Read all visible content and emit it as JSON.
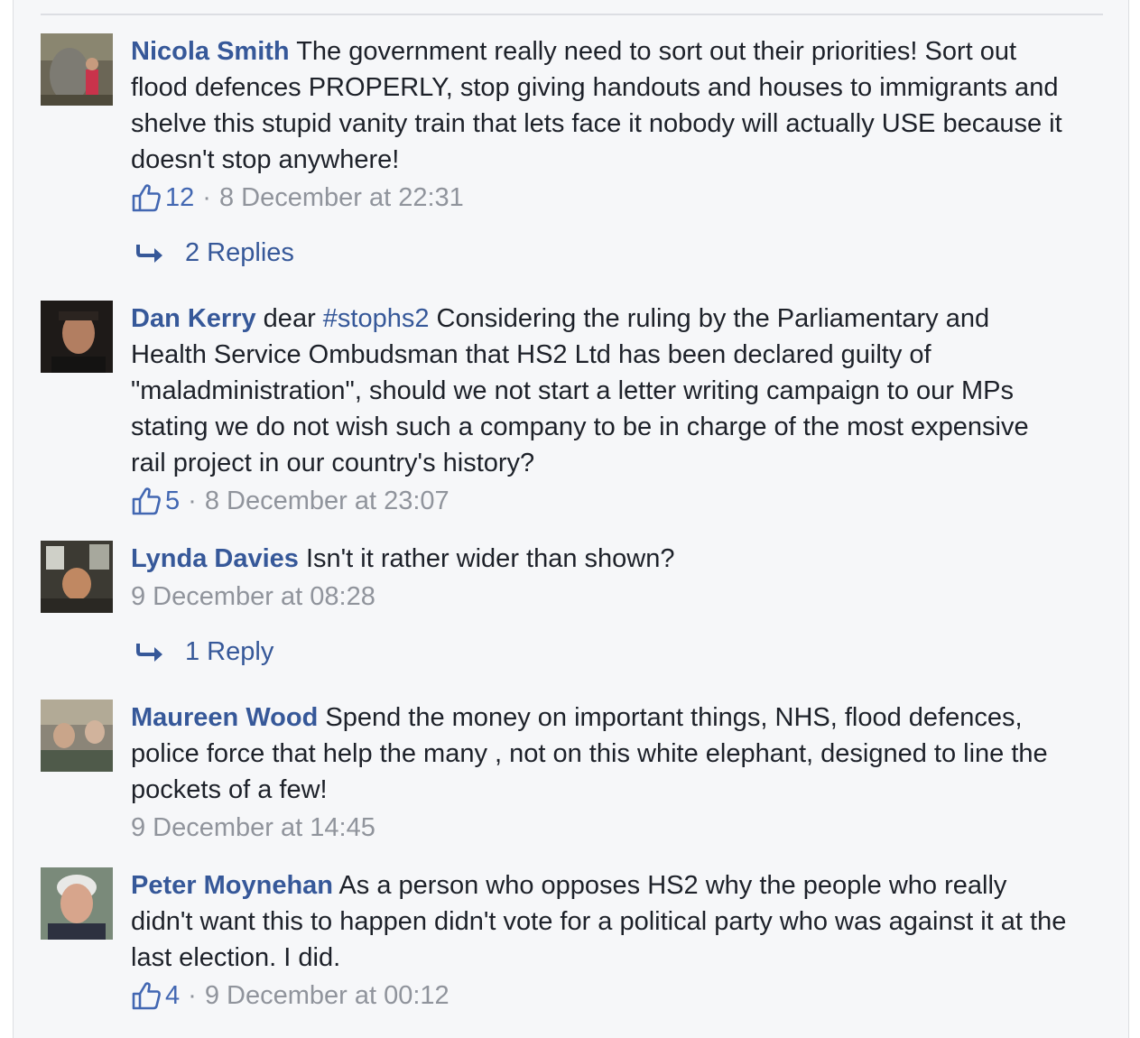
{
  "comments": [
    {
      "author": "Nicola Smith",
      "text": " The government really need to sort out their priorities! Sort out flood defences PROPERLY, stop giving handouts and houses to immigrants and shelve this stupid vanity train that lets face it nobody will actually USE because it doesn't stop anywhere!",
      "likes": "12",
      "timestamp": "8 December at 22:31",
      "replies_label": "2 Replies"
    },
    {
      "author": "Dan Kerry",
      "text_before_tag": " dear ",
      "tag": "#stophs2",
      "text": " Considering the ruling by the Parliamentary and Health Service Ombudsman that HS2 Ltd has been declared guilty of \"maladministration\", should we not start a letter writing campaign to our MPs stating we do not wish such a company to be in charge of the most expensive rail project in our country's history?",
      "likes": "5",
      "timestamp": "8 December at 23:07"
    },
    {
      "author": "Lynda Davies",
      "text": " Isn't it rather wider than shown?",
      "timestamp": "9 December at 08:28",
      "replies_label": "1 Reply"
    },
    {
      "author": "Maureen Wood",
      "text": " Spend the money on important things, NHS, flood defences, police force that help the many , not on this white elephant, designed to line the pockets of a few!",
      "timestamp": "9 December at 14:45"
    },
    {
      "author": "Peter Moynehan",
      "text": " As a person who opposes HS2 why the people who really didn't want this to happen didn't vote for a political party who was against it at the last election. I did.",
      "likes": "4",
      "timestamp": "9 December at 00:12"
    }
  ],
  "separator": "·",
  "icons": {
    "like": "thumbs-up-icon",
    "reply": "reply-arrow-icon"
  },
  "colors": {
    "name": "#365899",
    "text": "#1d2129",
    "meta": "#90949c",
    "like": "#4267b2",
    "background": "#f6f7f9"
  }
}
